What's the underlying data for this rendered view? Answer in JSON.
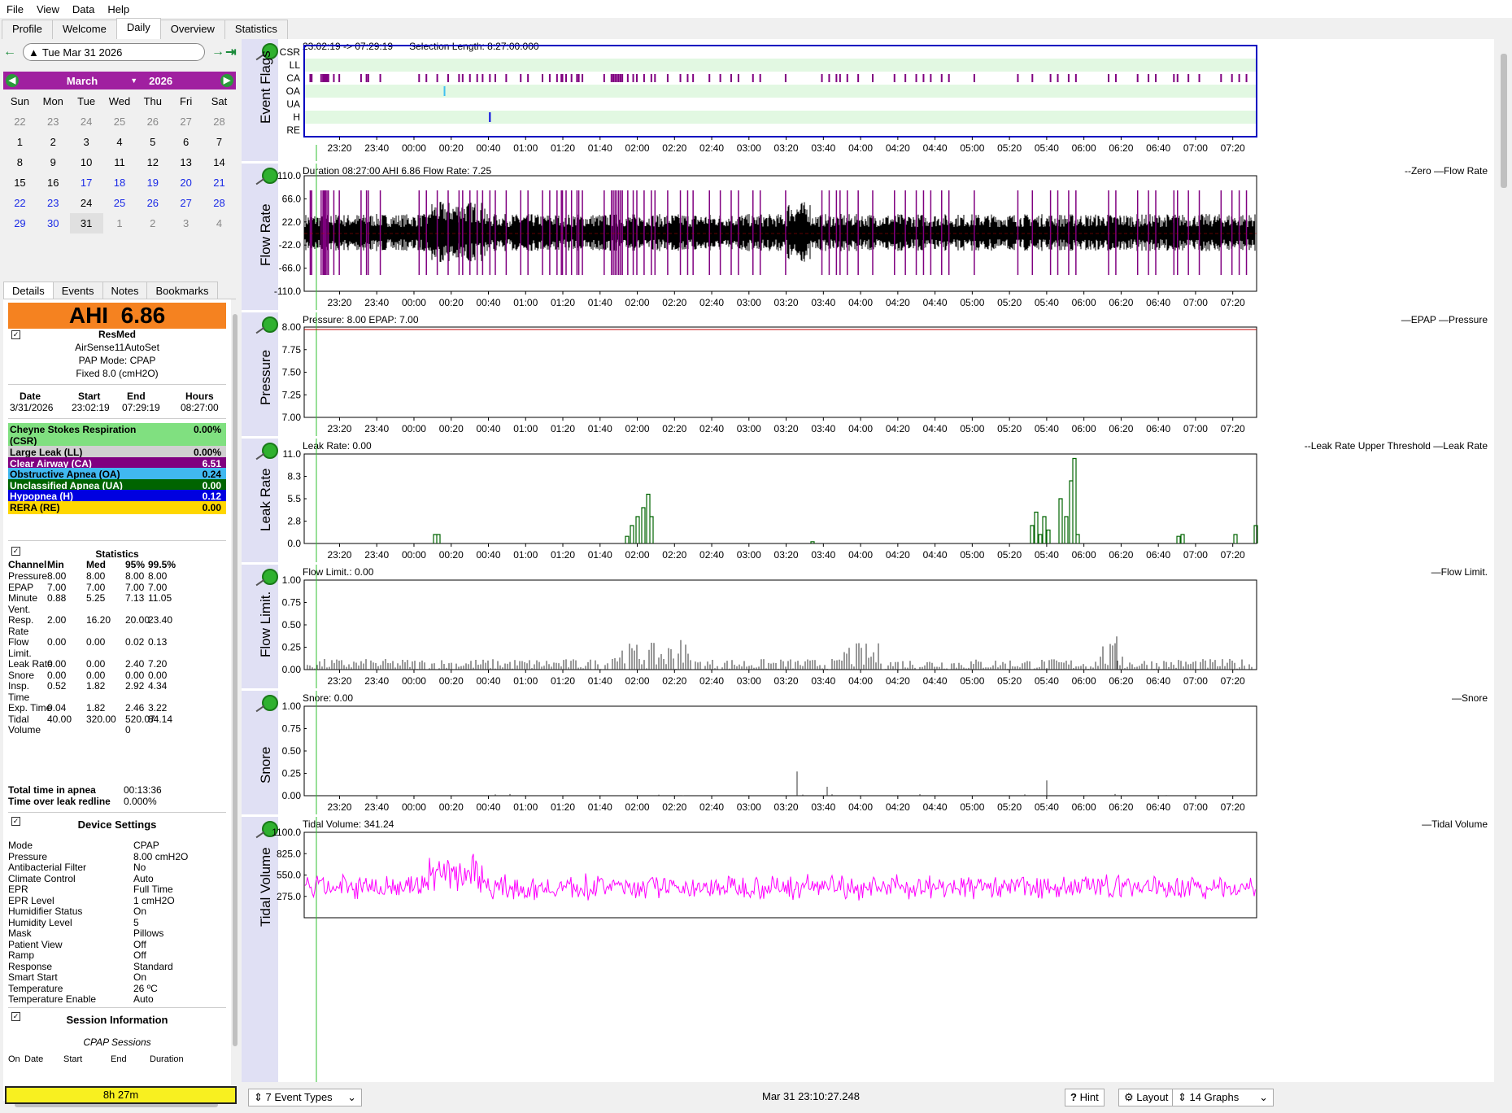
{
  "menu": {
    "file": "File",
    "view": "View",
    "data": "Data",
    "help": "Help"
  },
  "tabs": {
    "profile": "Profile",
    "welcome": "Welcome",
    "daily": "Daily",
    "overview": "Overview",
    "statistics": "Statistics"
  },
  "datebar": {
    "date": "Tue Mar 31 2026"
  },
  "calendar": {
    "month": "March",
    "year": "2026",
    "days": [
      "Sun",
      "Mon",
      "Tue",
      "Wed",
      "Thu",
      "Fri",
      "Sat"
    ],
    "weeks": [
      [
        [
          "22",
          "dim"
        ],
        [
          "23",
          "dim"
        ],
        [
          "24",
          "dim"
        ],
        [
          "25",
          "dim"
        ],
        [
          "26",
          "dim"
        ],
        [
          "27",
          "dim"
        ],
        [
          "28",
          "dim"
        ]
      ],
      [
        [
          "1",
          ""
        ],
        [
          "2",
          ""
        ],
        [
          "3",
          ""
        ],
        [
          "4",
          ""
        ],
        [
          "5",
          ""
        ],
        [
          "6",
          ""
        ],
        [
          "7",
          ""
        ]
      ],
      [
        [
          "8",
          ""
        ],
        [
          "9",
          ""
        ],
        [
          "10",
          ""
        ],
        [
          "11",
          ""
        ],
        [
          "12",
          ""
        ],
        [
          "13",
          ""
        ],
        [
          "14",
          ""
        ]
      ],
      [
        [
          "15",
          ""
        ],
        [
          "16",
          ""
        ],
        [
          "17",
          "blue"
        ],
        [
          "18",
          "blue"
        ],
        [
          "19",
          "blue"
        ],
        [
          "20",
          "blue"
        ],
        [
          "21",
          "blue"
        ]
      ],
      [
        [
          "22",
          "blue"
        ],
        [
          "23",
          "blue"
        ],
        [
          "24",
          ""
        ],
        [
          "25",
          "blue"
        ],
        [
          "26",
          "blue"
        ],
        [
          "27",
          "blue"
        ],
        [
          "28",
          "blue"
        ]
      ],
      [
        [
          "29",
          "blue"
        ],
        [
          "30",
          "blue"
        ],
        [
          "31",
          "sel"
        ],
        [
          "1",
          "dim"
        ],
        [
          "2",
          "dim"
        ],
        [
          "3",
          "dim"
        ],
        [
          "4",
          "dim"
        ]
      ]
    ]
  },
  "lefttabs": {
    "details": "Details",
    "events": "Events",
    "notes": "Notes",
    "bookmarks": "Bookmarks"
  },
  "summary": {
    "ahi_label": "AHI",
    "ahi": "6.86",
    "brand": "ResMed",
    "model": "AirSense11AutoSet",
    "mode": "PAP Mode: CPAP",
    "fixed": "Fixed 8.0 (cmH2O)",
    "date_h": "Date",
    "start_h": "Start",
    "end_h": "End",
    "hours_h": "Hours",
    "date": "3/31/2026",
    "start": "23:02:19",
    "end": "07:29:19",
    "hours": "08:27:00"
  },
  "events": [
    {
      "label": "Cheyne Stokes Respiration",
      "label2": "(CSR)",
      "value": "0.00%",
      "bg": "#80e080",
      "fg": "#000"
    },
    {
      "label": "Large Leak (LL)",
      "value": "0.00%",
      "bg": "#d0d0d0",
      "fg": "#000"
    },
    {
      "label": "Clear Airway (CA)",
      "value": "6.51",
      "bg": "#800080",
      "fg": "#fff"
    },
    {
      "label": "Obstructive Apnea (OA)",
      "value": "0.24",
      "bg": "#40b8f0",
      "fg": "#000"
    },
    {
      "label": "Unclassified Apnea (UA)",
      "value": "0.00",
      "bg": "#006400",
      "fg": "#fff"
    },
    {
      "label": "Hypopnea (H)",
      "value": "0.12",
      "bg": "#0000e0",
      "fg": "#fff"
    },
    {
      "label": "RERA (RE)",
      "value": "0.00",
      "bg": "#ffd700",
      "fg": "#000"
    }
  ],
  "statistics": {
    "title": "Statistics",
    "headers": [
      "Channel",
      "Min",
      "Med",
      "95%",
      "99.5%"
    ],
    "rows": [
      [
        "Pressure",
        "8.00",
        "8.00",
        "8.00",
        "8.00"
      ],
      [
        "EPAP",
        "7.00",
        "7.00",
        "7.00",
        "7.00"
      ],
      [
        "Minute\nVent.",
        "0.88",
        "5.25",
        "7.13",
        "11.05"
      ],
      [
        "Resp.\nRate",
        "2.00",
        "16.20",
        "20.00",
        "23.40"
      ],
      [
        "Flow\nLimit.",
        "0.00",
        "0.00",
        "0.02",
        "0.13"
      ],
      [
        "Leak Rate",
        "0.00",
        "0.00",
        "2.40",
        "7.20"
      ],
      [
        "Snore",
        "0.00",
        "0.00",
        "0.00",
        "0.00"
      ],
      [
        "Insp.\nTime",
        "0.52",
        "1.82",
        "2.92",
        "4.34"
      ],
      [
        "Exp. Time",
        "0.04",
        "1.82",
        "2.46",
        "3.22"
      ],
      [
        "Tidal\nVolume",
        "40.00",
        "320.00",
        "520.07",
        "84.14"
      ]
    ],
    "apnea_label": "Total time in apnea",
    "apnea": "00:13:36",
    "leak_label": "Time over leak redline",
    "leak": "0.000%",
    "volume_extra": "0"
  },
  "device": {
    "title": "Device Settings",
    "items": [
      [
        "Mode",
        "CPAP"
      ],
      [
        "Pressure",
        "8.00 cmH2O"
      ],
      [
        "Antibacterial Filter",
        "No"
      ],
      [
        "Climate Control",
        "Auto"
      ],
      [
        "EPR",
        "Full Time"
      ],
      [
        "EPR Level",
        "1 cmH2O"
      ],
      [
        "Humidifier Status",
        "On"
      ],
      [
        "Humidity Level",
        "5"
      ],
      [
        "Mask",
        "Pillows"
      ],
      [
        "Patient View",
        "Off"
      ],
      [
        "Ramp",
        "Off"
      ],
      [
        "Response",
        "Standard"
      ],
      [
        "Smart Start",
        "On"
      ],
      [
        "Temperature",
        "26 ºC"
      ],
      [
        "Temperature Enable",
        "Auto"
      ]
    ]
  },
  "session": {
    "title": "Session Information",
    "subtitle": "CPAP Sessions",
    "cols": [
      "On",
      "Date",
      "Start",
      "End",
      "Duration"
    ]
  },
  "bottom_left": "8h 27m",
  "time_ticks": [
    "23:20",
    "23:40",
    "00:00",
    "00:20",
    "00:40",
    "01:00",
    "01:20",
    "01:40",
    "02:00",
    "02:20",
    "02:40",
    "03:00",
    "03:20",
    "03:40",
    "04:00",
    "04:20",
    "04:40",
    "05:00",
    "05:20",
    "05:40",
    "06:00",
    "06:20",
    "06:40",
    "07:00",
    "07:20"
  ],
  "graphs": {
    "flags": {
      "ylabel": "Event Flags",
      "title": "23:02:19 -> 07:29:19      Selection Length: 8:27:00.000",
      "rows": [
        "CSR",
        "LL",
        "CA",
        "OA",
        "UA",
        "H",
        "RE"
      ]
    },
    "flow": {
      "ylabel": "Flow Rate",
      "title": "Duration 08:27:00 AHI 6.86 Flow Rate: 7.25",
      "legend": "--Zero —Flow Rate",
      "yticks": [
        "110.0",
        "66.0",
        "22.0",
        "-22.0",
        "-66.0",
        "-110.0"
      ]
    },
    "pressure": {
      "ylabel": "Pressure",
      "title": "Pressure: 8.00 EPAP: 7.00",
      "legend": "—EPAP —Pressure",
      "yticks": [
        "8.00",
        "7.75",
        "7.50",
        "7.25",
        "7.00"
      ]
    },
    "leak": {
      "ylabel": "Leak Rate",
      "title": "Leak Rate: 0.00",
      "legend": "--Leak Rate Upper Threshold —Leak Rate",
      "yticks": [
        "11.0",
        "8.3",
        "5.5",
        "2.8",
        "0.0"
      ]
    },
    "flowlim": {
      "ylabel": "Flow Limit.",
      "title": "Flow Limit.: 0.00",
      "legend": "—Flow Limit.",
      "yticks": [
        "1.00",
        "0.75",
        "0.50",
        "0.25",
        "0.00"
      ]
    },
    "snore": {
      "ylabel": "Snore",
      "title": "Snore: 0.00",
      "legend": "—Snore",
      "yticks": [
        "1.00",
        "0.75",
        "0.50",
        "0.25",
        "0.00"
      ]
    },
    "tidal": {
      "ylabel": "Tidal Volume",
      "title": "Tidal Volume: 341.24",
      "legend": "—Tidal Volume",
      "yticks": [
        "1100.0",
        "825.0",
        "550.0",
        "275.0"
      ]
    }
  },
  "status": {
    "event_types": "7 Event Types",
    "clock": "Mar 31 23:10:27.248",
    "hint": "Hint",
    "layout": "Layout",
    "graphs": "14 Graphs"
  },
  "colors": {
    "purple": "#800080",
    "cyan": "#40c0f0",
    "blue": "#0000e0",
    "green": "#006400",
    "magenta": "#ff00ff",
    "red": "#c00000"
  }
}
